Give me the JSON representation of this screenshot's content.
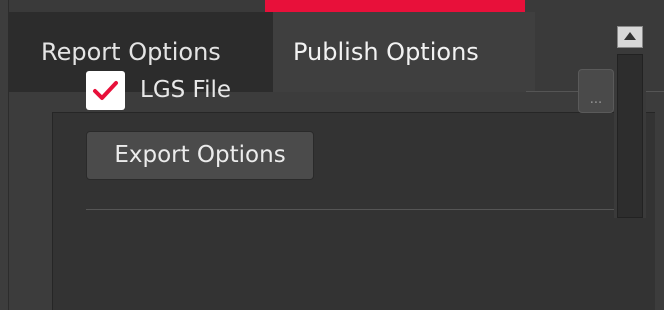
{
  "tabs": {
    "report_label": "Report Options",
    "publish_label": "Publish Options",
    "active": "Publish Options"
  },
  "publish": {
    "lgs_file": {
      "label": "LGS File",
      "checked": true
    },
    "browse_label": "...",
    "export_options_label": "Export Options"
  },
  "colors": {
    "accent": "#e8103a",
    "check": "#e8103a",
    "background": "#3a3a3a"
  },
  "icons": {
    "checkmark": "checkmark-icon",
    "scroll_up": "arrow-up-icon"
  }
}
